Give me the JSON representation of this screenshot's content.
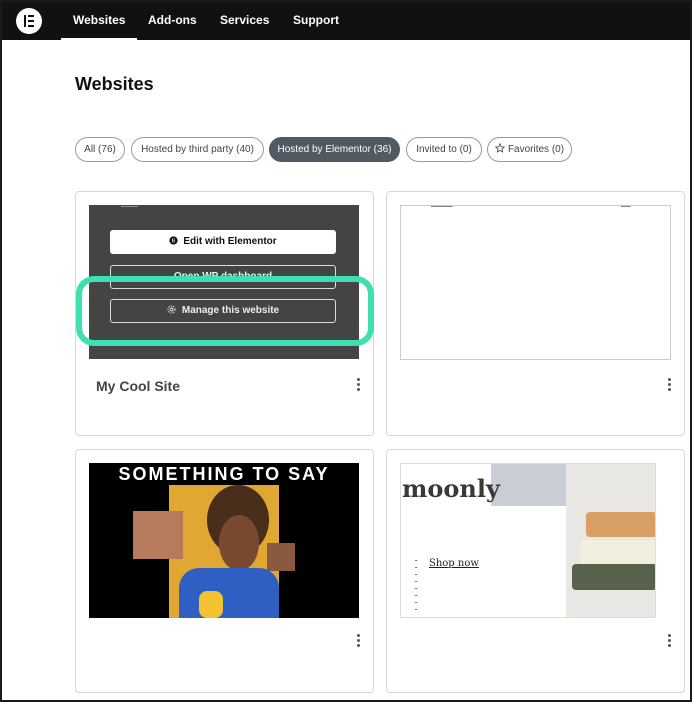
{
  "nav": {
    "items": [
      {
        "label": "Websites",
        "active": true
      },
      {
        "label": "Add-ons",
        "active": false
      },
      {
        "label": "Services",
        "active": false
      },
      {
        "label": "Support",
        "active": false
      }
    ]
  },
  "page": {
    "title": "Websites"
  },
  "filters": [
    {
      "label": "All (76)",
      "active": false
    },
    {
      "label": "Hosted by third party (40)",
      "active": false
    },
    {
      "label": "Hosted by Elementor (36)",
      "active": true
    },
    {
      "label": "Invited to (0)",
      "active": false
    },
    {
      "label": "Favorites (0)",
      "active": false,
      "icon": "star-icon"
    }
  ],
  "cards": [
    {
      "title": "My Cool Site",
      "overlay": {
        "edit_label": "Edit with Elementor",
        "dashboard_label": "Open WP dashboard",
        "manage_label": "Manage this website"
      }
    },
    {
      "title": ""
    },
    {
      "title": "",
      "thumb_headline": "SOMETHING TO SAY"
    },
    {
      "title": "",
      "thumb_brand": "moonly",
      "thumb_cta": "Shop now"
    }
  ],
  "colors": {
    "topbar": "#111111",
    "active_chip": "#515962",
    "highlight": "#3ee0b0"
  }
}
